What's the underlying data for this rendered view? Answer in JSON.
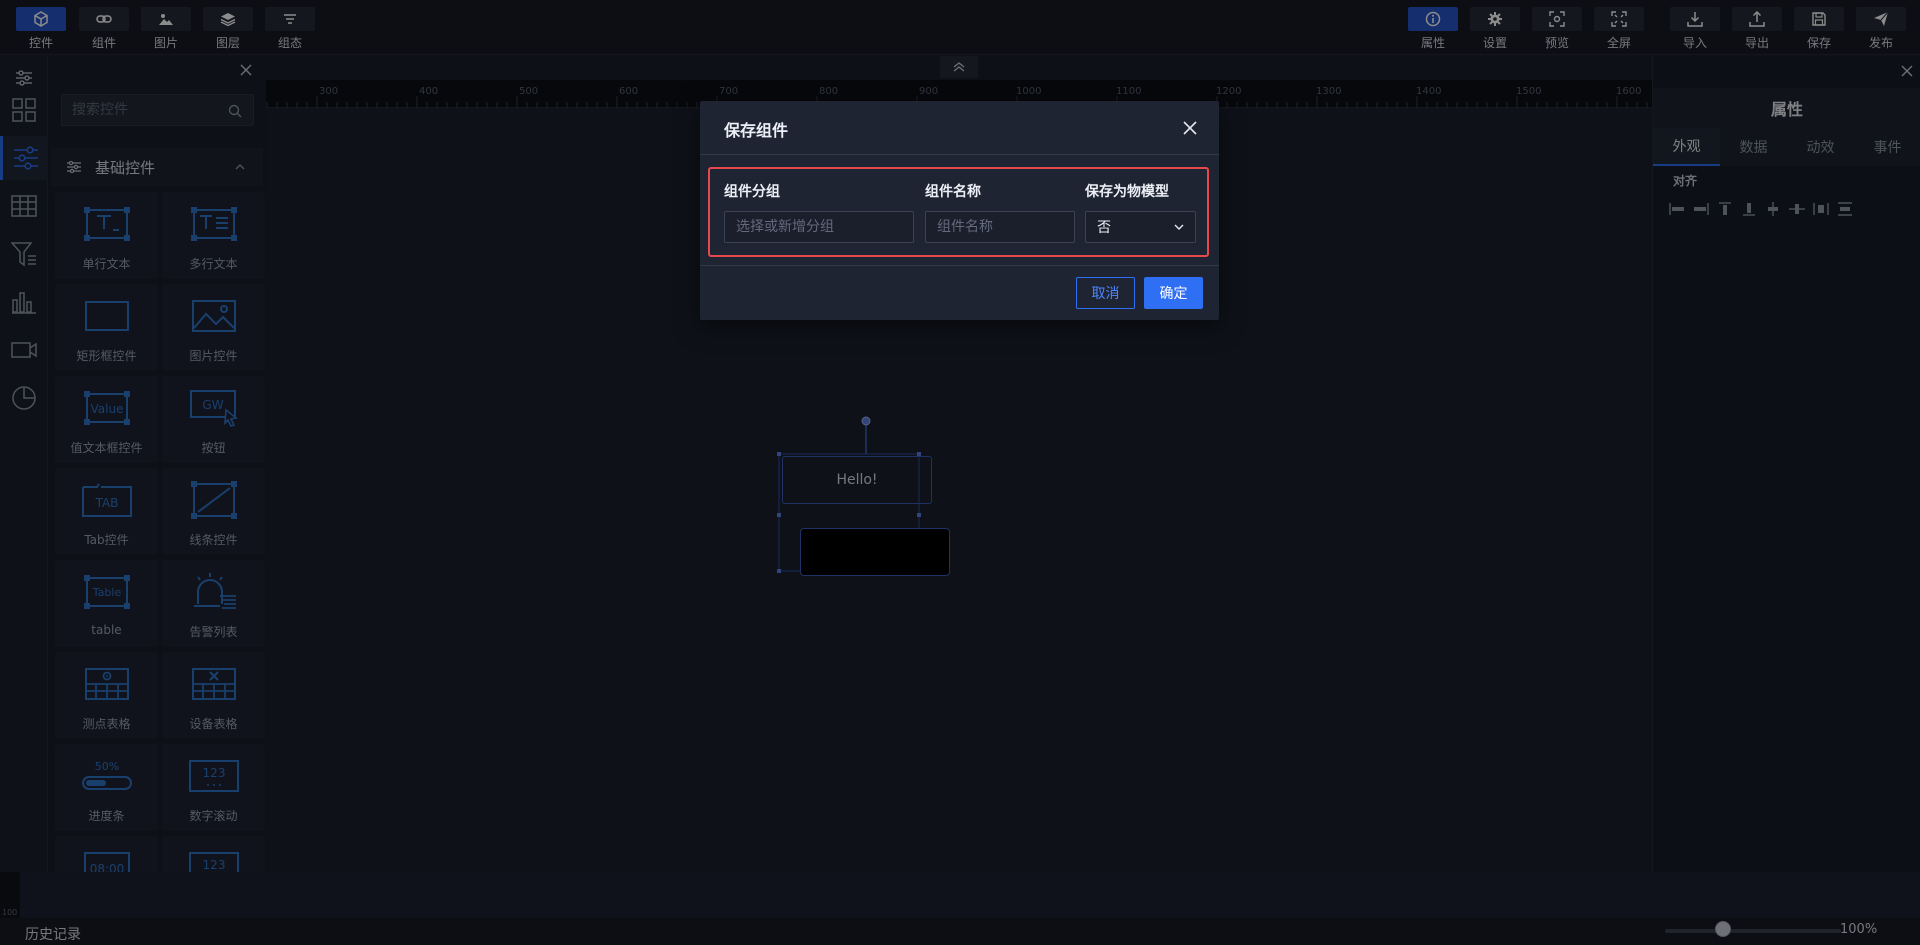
{
  "toolbar_left": [
    {
      "label": "控件",
      "icon": "cube-icon",
      "active": true
    },
    {
      "label": "组件",
      "icon": "link-icon"
    },
    {
      "label": "图片",
      "icon": "image-icon"
    },
    {
      "label": "图层",
      "icon": "layers-icon"
    },
    {
      "label": "组态",
      "icon": "config-icon"
    }
  ],
  "toolbar_right": [
    {
      "label": "属性",
      "icon": "info-icon",
      "active": true
    },
    {
      "label": "设置",
      "icon": "gear-icon"
    },
    {
      "label": "预览",
      "icon": "preview-icon"
    },
    {
      "label": "全屏",
      "icon": "fullscreen-icon"
    },
    {
      "label": "导入",
      "icon": "import-icon"
    },
    {
      "label": "导出",
      "icon": "export-icon"
    },
    {
      "label": "保存",
      "icon": "save-icon"
    },
    {
      "label": "发布",
      "icon": "publish-icon"
    }
  ],
  "left_panel": {
    "search_placeholder": "搜索控件",
    "category": "基础控件",
    "widgets": [
      "单行文本",
      "多行文本",
      "矩形框控件",
      "图片控件",
      "值文本框控件",
      "按钮",
      "Tab控件",
      "线条控件",
      "table",
      "告警列表",
      "测点表格",
      "设备表格",
      "进度条",
      "数字滚动"
    ],
    "icon_texts": {
      "value": "Value",
      "gw": "GW",
      "tab": "TAB",
      "table": "Table",
      "percent": "50%",
      "num": "123",
      "time": "08:00"
    }
  },
  "ruler_ticks": [
    "300",
    "400",
    "500",
    "600",
    "700",
    "800",
    "900",
    "1000",
    "1100",
    "1200",
    "1300",
    "1400",
    "1500",
    "1600"
  ],
  "canvas": {
    "text": "Hello!"
  },
  "right_panel": {
    "title": "属性",
    "tabs": [
      "外观",
      "数据",
      "动效",
      "事件"
    ],
    "align_label": "对齐"
  },
  "bottom": {
    "history": "历史记录",
    "zoom": "100%",
    "zoom_level": 1.0,
    "ruler_label": "100"
  },
  "dialog": {
    "title": "保存组件",
    "group_label": "组件分组",
    "group_placeholder": "选择或新增分组",
    "name_label": "组件名称",
    "name_placeholder": "组件名称",
    "model_label": "保存为物模型",
    "model_value": "否",
    "cancel": "取消",
    "confirm": "确定"
  },
  "colors": {
    "accent": "#2f6ff3",
    "highlight": "#e5484d",
    "icon_blue": "#2f74c6"
  }
}
